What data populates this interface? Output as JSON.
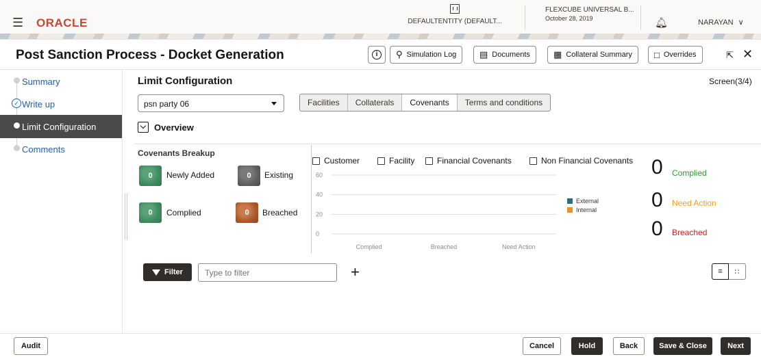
{
  "header": {
    "logo": "ORACLE",
    "entity": "DEFAULTENTITY (DEFAULT...",
    "product": "FLEXCUBE UNIVERSAL B...",
    "date": "October 28, 2019",
    "user": "NARAYAN"
  },
  "titlebar": {
    "title": "Post Sanction Process - Docket Generation",
    "info_label": "i",
    "buttons": {
      "simulation_log": "Simulation Log",
      "documents": "Documents",
      "collateral_summary": "Collateral Summary",
      "overrides": "Overrides"
    }
  },
  "sidebar": {
    "items": [
      {
        "label": "Summary"
      },
      {
        "label": "Write up"
      },
      {
        "label": "Limit Configuration"
      },
      {
        "label": "Comments"
      }
    ]
  },
  "main": {
    "section_title": "Limit Configuration",
    "screen_count": "Screen(3/4)",
    "party_select": "psn party 06",
    "tabs": [
      "Facilities",
      "Collaterals",
      "Covenants",
      "Terms and conditions"
    ],
    "overview": "Overview"
  },
  "breakup": {
    "title": "Covenants Breakup",
    "newly_added": {
      "count": "0",
      "label": "Newly Added"
    },
    "existing": {
      "count": "0",
      "label": "Existing"
    },
    "complied": {
      "count": "0",
      "label": "Complied"
    },
    "breached": {
      "count": "0",
      "label": "Breached"
    }
  },
  "chart_filters": [
    "Customer",
    "Facility",
    "Financial Covenants",
    "Non Financial Covenants"
  ],
  "chart_data": {
    "type": "bar",
    "categories": [
      "Complied",
      "Breached",
      "Need Action"
    ],
    "series": [
      {
        "name": "External",
        "values": [
          0,
          0,
          0
        ]
      },
      {
        "name": "Internal",
        "values": [
          0,
          0,
          0
        ]
      }
    ],
    "yticks": [
      "60",
      "40",
      "20",
      "0"
    ],
    "ylim": [
      0,
      60
    ],
    "grid": true,
    "legend": "right",
    "colors": {
      "External": "#2f6f73",
      "Internal": "#e8902a"
    }
  },
  "counts": {
    "complied": {
      "value": "0",
      "label": "Complied",
      "color": "#2d9a2d"
    },
    "need_action": {
      "value": "0",
      "label": "Need Action",
      "color": "#f0a21c"
    },
    "breached": {
      "value": "0",
      "label": "Breached",
      "color": "#d01e1e"
    }
  },
  "filter": {
    "button": "Filter",
    "placeholder": "Type to filter"
  },
  "footer": {
    "audit": "Audit",
    "cancel": "Cancel",
    "hold": "Hold",
    "back": "Back",
    "save_close": "Save & Close",
    "next": "Next"
  }
}
